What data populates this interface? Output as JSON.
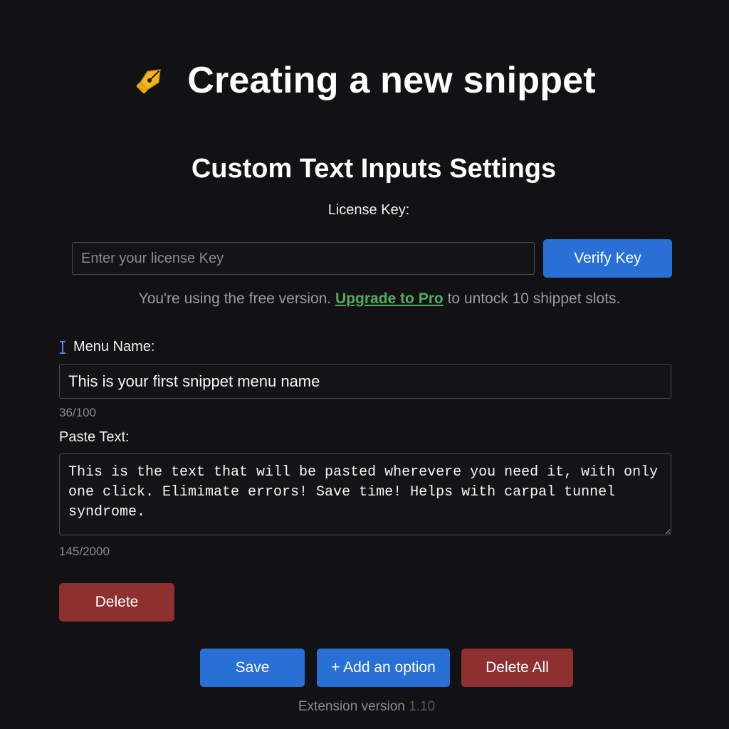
{
  "header": {
    "title": "Creating a new snippet",
    "icon": "pen-icon"
  },
  "settings": {
    "title": "Custom Text Inputs Settings",
    "license_label": "License Key:",
    "license_placeholder": "Enter your license Key",
    "license_value": "",
    "verify_label": "Verify Key",
    "free_note_prefix": "You're using the free version.",
    "upgrade_link": "Upgrade to Pro",
    "free_note_suffix": "to untock 10 shippet slots."
  },
  "menu_name": {
    "label": "Menu Name:",
    "value": "This is your first snippet menu name",
    "counter": "36/100"
  },
  "paste_text": {
    "label": "Paste Text:",
    "value": "This is the text that will be pasted wherevere you need it, with only one click. Elimimate errors! Save time! Helps with carpal tunnel syndrome.",
    "counter": "145/2000"
  },
  "buttons": {
    "delete": "Delete",
    "save": "Save",
    "add_option": "+ Add an option",
    "delete_all": "Delete All"
  },
  "footer": {
    "version_label": "Extension version",
    "version_number": "1.10"
  },
  "colors": {
    "background": "#121114",
    "primary_blue": "#2870d6",
    "danger_red": "#8f3030",
    "link_green": "#4fae5c"
  }
}
